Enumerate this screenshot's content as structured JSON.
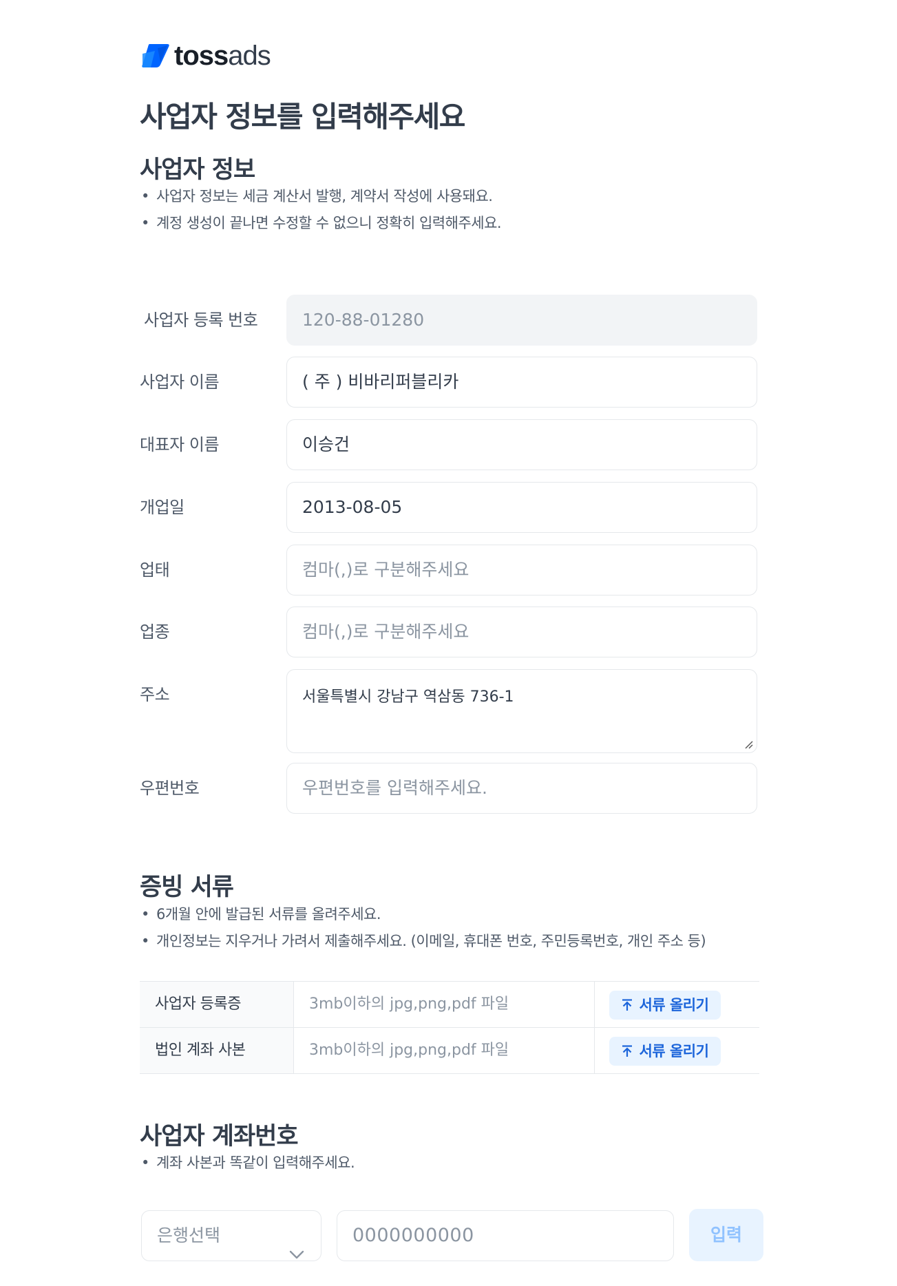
{
  "brand": {
    "bold": "toss",
    "light": "ads"
  },
  "page_title": "사업자 정보를 입력해주세요",
  "business_info": {
    "title": "사업자 정보",
    "notes": [
      "사업자 정보는 세금 계산서 발행, 계약서 작성에 사용돼요.",
      "계정 생성이 끝나면 수정할 수 없으니 정확히 입력해주세요."
    ],
    "fields": {
      "reg_number": {
        "label": "사업자 등록 번호",
        "value": "120-88-01280"
      },
      "business_name": {
        "label": "사업자 이름",
        "value": "( 주 ) 비바리퍼블리카"
      },
      "ceo_name": {
        "label": "대표자 이름",
        "value": "이승건"
      },
      "open_date": {
        "label": "개업일",
        "value": "2013-08-05"
      },
      "business_type": {
        "label": "업태",
        "placeholder": "컴마(,)로 구분해주세요"
      },
      "business_item": {
        "label": "업종",
        "placeholder": "컴마(,)로 구분해주세요"
      },
      "address": {
        "label": "주소",
        "value": "서울특별시 강남구 역삼동 736-1"
      },
      "postal_code": {
        "label": "우편번호",
        "placeholder": "우편번호를 입력해주세요."
      }
    }
  },
  "documents": {
    "title": "증빙 서류",
    "notes": [
      "6개월 안에 발급된 서류를 올려주세요.",
      "개인정보는 지우거나 가려서 제출해주세요. (이메일, 휴대폰 번호, 주민등록번호, 개인 주소 등)"
    ],
    "rows": [
      {
        "label": "사업자 등록증",
        "hint": "3mb이하의 jpg,png,pdf 파일",
        "button": "서류 올리기"
      },
      {
        "label": "법인 계좌 사본",
        "hint": "3mb이하의 jpg,png,pdf 파일",
        "button": "서류 올리기"
      }
    ]
  },
  "account": {
    "title": "사업자 계좌번호",
    "notes": [
      "계좌 사본과 똑같이 입력해주세요."
    ],
    "bank_select_placeholder": "은행선택",
    "account_placeholder": "0000000000",
    "submit_label": "입력"
  },
  "colors": {
    "primary": "#3182f6",
    "primary_light": "#e8f3ff",
    "text_dark": "#333d4b",
    "text_gray": "#8b95a1",
    "border": "#e5e8eb"
  }
}
